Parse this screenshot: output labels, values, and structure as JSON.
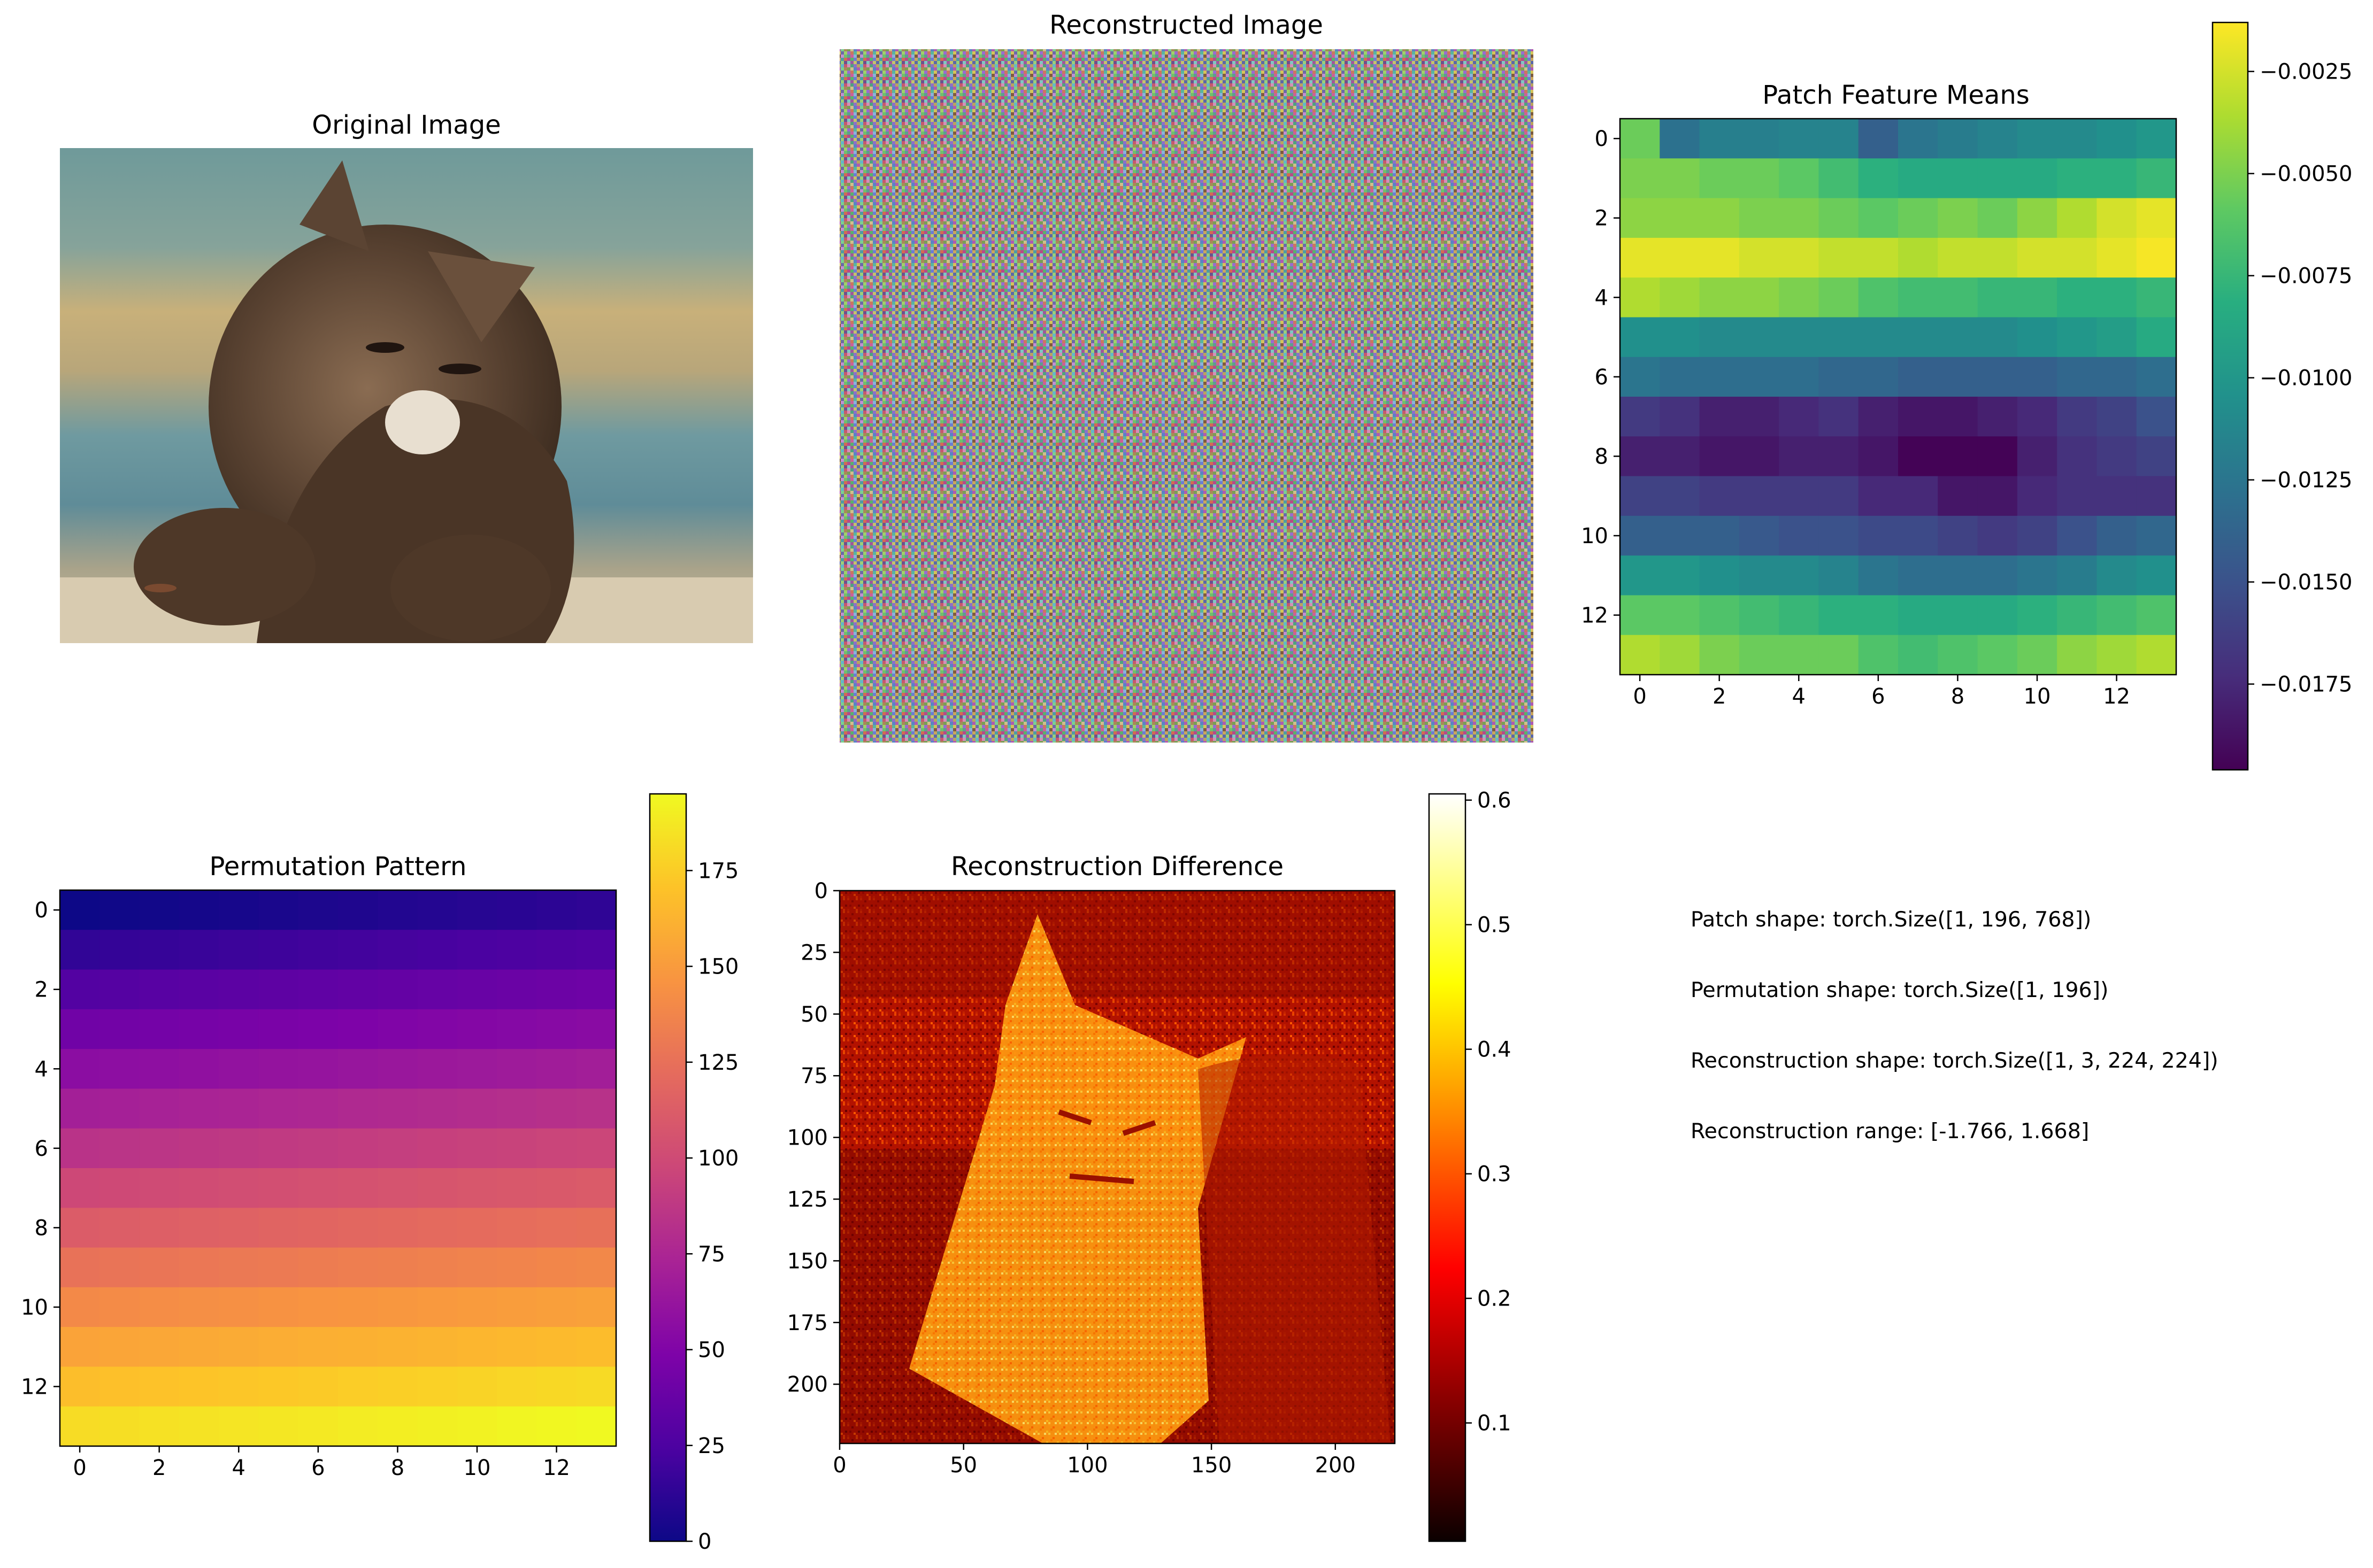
{
  "chart_data": [
    {
      "type": "image",
      "title": "Original Image",
      "description": "photograph of a tabby kitten resting its paws on a ledge, blue and tan striped background"
    },
    {
      "type": "image",
      "title": "Reconstructed Image",
      "description": "colorful pixel noise with faint repeating grid pattern"
    },
    {
      "type": "heatmap",
      "title": "Patch Feature Means",
      "colormap": "viridis",
      "rows": 14,
      "cols": 14,
      "x_ticks": [
        "0",
        "2",
        "4",
        "6",
        "8",
        "10",
        "12"
      ],
      "y_ticks": [
        "0",
        "2",
        "4",
        "6",
        "8",
        "10",
        "12"
      ],
      "colorbar": {
        "range": [
          -0.0196,
          -0.0013
        ],
        "ticks": [
          "−0.0025",
          "−0.0050",
          "−0.0075",
          "−0.0100",
          "−0.0125",
          "−0.0150",
          "−0.0175"
        ],
        "tick_values": [
          -0.0025,
          -0.005,
          -0.0075,
          -0.01,
          -0.0125,
          -0.015,
          -0.0175
        ]
      },
      "values": [
        [
          -0.0055,
          -0.0128,
          -0.0118,
          -0.0118,
          -0.0115,
          -0.0115,
          -0.014,
          -0.0125,
          -0.012,
          -0.0115,
          -0.011,
          -0.011,
          -0.0105,
          -0.01
        ],
        [
          -0.005,
          -0.005,
          -0.0055,
          -0.0055,
          -0.006,
          -0.007,
          -0.008,
          -0.0085,
          -0.0085,
          -0.0085,
          -0.0085,
          -0.008,
          -0.008,
          -0.0075
        ],
        [
          -0.0045,
          -0.0045,
          -0.0045,
          -0.005,
          -0.005,
          -0.0055,
          -0.006,
          -0.0055,
          -0.005,
          -0.0055,
          -0.0045,
          -0.0035,
          -0.0025,
          -0.002
        ],
        [
          -0.002,
          -0.002,
          -0.002,
          -0.0025,
          -0.0025,
          -0.003,
          -0.003,
          -0.0035,
          -0.003,
          -0.003,
          -0.0025,
          -0.0025,
          -0.002,
          -0.0015
        ],
        [
          -0.0035,
          -0.004,
          -0.0045,
          -0.0045,
          -0.005,
          -0.0055,
          -0.0065,
          -0.007,
          -0.007,
          -0.0075,
          -0.0075,
          -0.008,
          -0.008,
          -0.0075
        ],
        [
          -0.0105,
          -0.0105,
          -0.011,
          -0.011,
          -0.011,
          -0.011,
          -0.011,
          -0.011,
          -0.011,
          -0.011,
          -0.0105,
          -0.01,
          -0.0095,
          -0.0085
        ],
        [
          -0.0125,
          -0.013,
          -0.013,
          -0.013,
          -0.013,
          -0.0135,
          -0.0135,
          -0.014,
          -0.014,
          -0.014,
          -0.014,
          -0.0135,
          -0.0135,
          -0.013
        ],
        [
          -0.0165,
          -0.017,
          -0.018,
          -0.018,
          -0.0175,
          -0.017,
          -0.018,
          -0.0185,
          -0.0185,
          -0.018,
          -0.0175,
          -0.0165,
          -0.016,
          -0.015
        ],
        [
          -0.018,
          -0.018,
          -0.0185,
          -0.0185,
          -0.018,
          -0.018,
          -0.0185,
          -0.0195,
          -0.0195,
          -0.0195,
          -0.018,
          -0.017,
          -0.0165,
          -0.016
        ],
        [
          -0.016,
          -0.016,
          -0.0165,
          -0.0165,
          -0.0165,
          -0.0165,
          -0.0175,
          -0.0175,
          -0.0185,
          -0.0185,
          -0.0175,
          -0.017,
          -0.017,
          -0.017
        ],
        [
          -0.014,
          -0.014,
          -0.014,
          -0.0145,
          -0.015,
          -0.015,
          -0.0155,
          -0.0155,
          -0.016,
          -0.0165,
          -0.016,
          -0.015,
          -0.014,
          -0.0135
        ],
        [
          -0.01,
          -0.01,
          -0.0105,
          -0.011,
          -0.011,
          -0.0115,
          -0.0125,
          -0.013,
          -0.013,
          -0.013,
          -0.0125,
          -0.012,
          -0.011,
          -0.0105
        ],
        [
          -0.006,
          -0.006,
          -0.0065,
          -0.007,
          -0.0075,
          -0.008,
          -0.008,
          -0.0085,
          -0.0085,
          -0.0085,
          -0.008,
          -0.0075,
          -0.007,
          -0.0065
        ],
        [
          -0.0035,
          -0.004,
          -0.005,
          -0.0055,
          -0.0055,
          -0.0055,
          -0.0065,
          -0.007,
          -0.0065,
          -0.006,
          -0.0055,
          -0.0045,
          -0.004,
          -0.0035
        ]
      ]
    },
    {
      "type": "heatmap",
      "title": "Permutation Pattern",
      "colormap": "plasma",
      "rows": 14,
      "cols": 14,
      "x_ticks": [
        "0",
        "2",
        "4",
        "6",
        "8",
        "10",
        "12"
      ],
      "y_ticks": [
        "0",
        "2",
        "4",
        "6",
        "8",
        "10",
        "12"
      ],
      "colorbar": {
        "range": [
          0,
          195
        ],
        "ticks": [
          "0",
          "25",
          "50",
          "75",
          "100",
          "125",
          "150",
          "175"
        ],
        "tick_values": [
          0,
          25,
          50,
          75,
          100,
          125,
          150,
          175
        ]
      },
      "values_rule": "value = row*14 + col (row-major patch index 0–195)"
    },
    {
      "type": "heatmap",
      "title": "Reconstruction Difference",
      "colormap": "hot",
      "extent": [
        0,
        224,
        224,
        0
      ],
      "x_ticks": [
        "0",
        "50",
        "100",
        "150",
        "200"
      ],
      "x_tick_values": [
        0,
        50,
        100,
        150,
        200
      ],
      "y_ticks": [
        "0",
        "25",
        "50",
        "75",
        "100",
        "125",
        "150",
        "175",
        "200"
      ],
      "y_tick_values": [
        0,
        25,
        50,
        75,
        100,
        125,
        150,
        175,
        200
      ],
      "colorbar": {
        "range": [
          0.005,
          0.605
        ],
        "ticks": [
          "0.1",
          "0.2",
          "0.3",
          "0.4",
          "0.5",
          "0.6"
        ],
        "tick_values": [
          0.1,
          0.2,
          0.3,
          0.4,
          0.5,
          0.6
        ]
      },
      "description": "absolute difference map revealing the kitten silhouette in bright orange/yellow against dark red"
    }
  ],
  "info_text": [
    "Patch shape: torch.Size([1, 196, 768])",
    "Permutation shape: torch.Size([1, 196])",
    "Reconstruction shape: torch.Size([1, 3, 224, 224])",
    "Reconstruction range: [-1.766, 1.668]"
  ]
}
